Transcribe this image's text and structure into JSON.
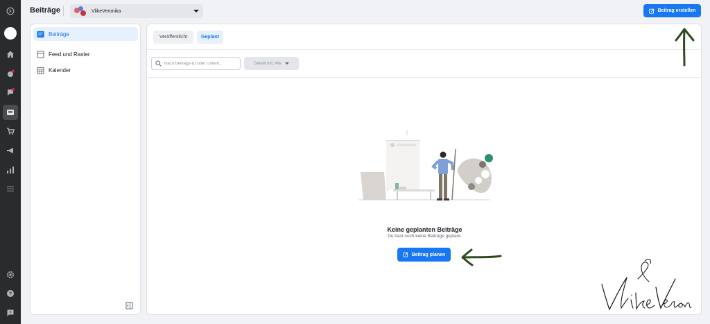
{
  "header": {
    "title": "Beiträge",
    "account_name": "VlikeVeronika",
    "create_button": "Beitrag erstellen"
  },
  "rail": {
    "icons": [
      "meta-logo-icon",
      "avatar",
      "home-icon",
      "notification-icon",
      "messages-icon",
      "posts-icon",
      "shop-icon",
      "ads-icon",
      "insights-icon",
      "menu-icon",
      "settings-icon",
      "help-icon",
      "feedback-icon"
    ]
  },
  "sidebar": {
    "items": [
      {
        "label": "Beiträge",
        "icon": "posts-icon",
        "active": true
      },
      {
        "label": "Feed und Raster",
        "icon": "feed-icon",
        "active": false
      },
      {
        "label": "Kalender",
        "icon": "calendar-icon",
        "active": false
      }
    ]
  },
  "main": {
    "tabs": [
      {
        "label": "Veröffentlicht",
        "active": false
      },
      {
        "label": "Geplant",
        "active": true
      }
    ],
    "search": {
      "placeholder": "Nach Beitrags-ID oder Unterti..."
    },
    "filter": {
      "label": "Geteilt mit: Alle"
    },
    "empty_state": {
      "title": "Keine geplanten Beiträge",
      "subtitle": "Du hast noch keine Beiträge geplant.",
      "button": "Beitrag planen"
    }
  },
  "colors": {
    "accent": "#1877f2",
    "rail_bg": "#2a2b2c",
    "annotation_arrow": "#2d4a1e"
  }
}
